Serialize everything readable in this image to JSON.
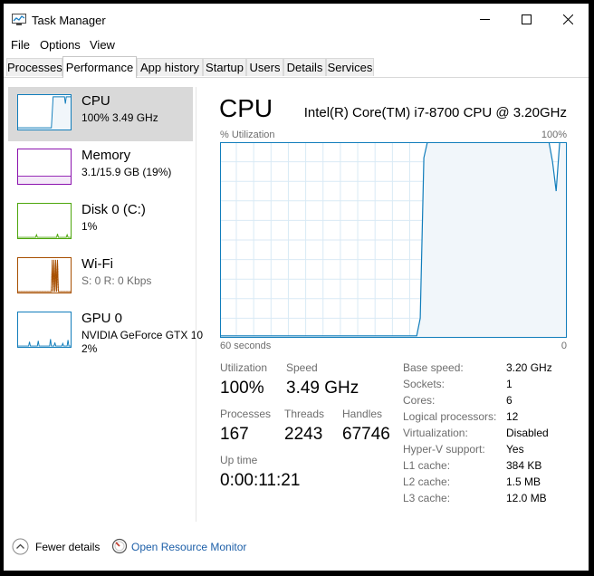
{
  "window": {
    "title": "Task Manager"
  },
  "menu": [
    "File",
    "Options",
    "View"
  ],
  "tabs": [
    "Processes",
    "Performance",
    "App history",
    "Startup",
    "Users",
    "Details",
    "Services"
  ],
  "active_tab": "Performance",
  "sidebar": {
    "items": [
      {
        "name": "CPU",
        "line1": "100%  3.49 GHz",
        "color": "#117dbb"
      },
      {
        "name": "Memory",
        "line1": "3.1/15.9 GB (19%)",
        "color": "#8b12ae"
      },
      {
        "name": "Disk 0 (C:)",
        "line1": "1%",
        "color": "#4da60c"
      },
      {
        "name": "Wi-Fi",
        "line1": "S: 0 R: 0 Kbps",
        "color": "#a74f01"
      },
      {
        "name": "GPU 0",
        "line1": "NVIDIA GeForce GTX 10",
        "line2": "2%",
        "color": "#117dbb"
      }
    ]
  },
  "main": {
    "title": "CPU",
    "model": "Intel(R) Core(TM) i7-8700 CPU @ 3.20GHz",
    "utilization_label": "% Utilization",
    "max_label": "100%",
    "time_label": "60 seconds",
    "min_label": "0",
    "stats": {
      "utilization": {
        "label": "Utilization",
        "value": "100%"
      },
      "speed": {
        "label": "Speed",
        "value": "3.49 GHz"
      },
      "processes": {
        "label": "Processes",
        "value": "167"
      },
      "threads": {
        "label": "Threads",
        "value": "2243"
      },
      "handles": {
        "label": "Handles",
        "value": "67746"
      },
      "uptime": {
        "label": "Up time",
        "value": "0:00:11:21"
      }
    },
    "specs": [
      {
        "key": "Base speed:",
        "value": "3.20 GHz"
      },
      {
        "key": "Sockets:",
        "value": "1"
      },
      {
        "key": "Cores:",
        "value": "6"
      },
      {
        "key": "Logical processors:",
        "value": "12"
      },
      {
        "key": "Virtualization:",
        "value": "Disabled"
      },
      {
        "key": "Hyper-V support:",
        "value": "Yes"
      },
      {
        "key": "L1 cache:",
        "value": "384 KB"
      },
      {
        "key": "L2 cache:",
        "value": "1.5 MB"
      },
      {
        "key": "L3 cache:",
        "value": "12.0 MB"
      }
    ],
    "cpu_history_percent": [
      1,
      1,
      1,
      1,
      1,
      1,
      1,
      1,
      1,
      1,
      1,
      1,
      1,
      1,
      1,
      1,
      1,
      1,
      1,
      1,
      1,
      1,
      1,
      1,
      1,
      1,
      1,
      1,
      1,
      1,
      1,
      1,
      1,
      1,
      1,
      1,
      1,
      1,
      1,
      1,
      1,
      1,
      1,
      1,
      1,
      1,
      1,
      1,
      1,
      1,
      1,
      1,
      1,
      1,
      1,
      1,
      10,
      92,
      100,
      100,
      100,
      100,
      100,
      100,
      100,
      100,
      100,
      100,
      100,
      100,
      100,
      100,
      100,
      100,
      100,
      100,
      100,
      100,
      100,
      100,
      100,
      100,
      100,
      100,
      100,
      100,
      100,
      100,
      100,
      100,
      100,
      100,
      100,
      90,
      75,
      100,
      100,
      100
    ]
  },
  "footer": {
    "fewer_details": "Fewer details",
    "resource_monitor": "Open Resource Monitor"
  }
}
